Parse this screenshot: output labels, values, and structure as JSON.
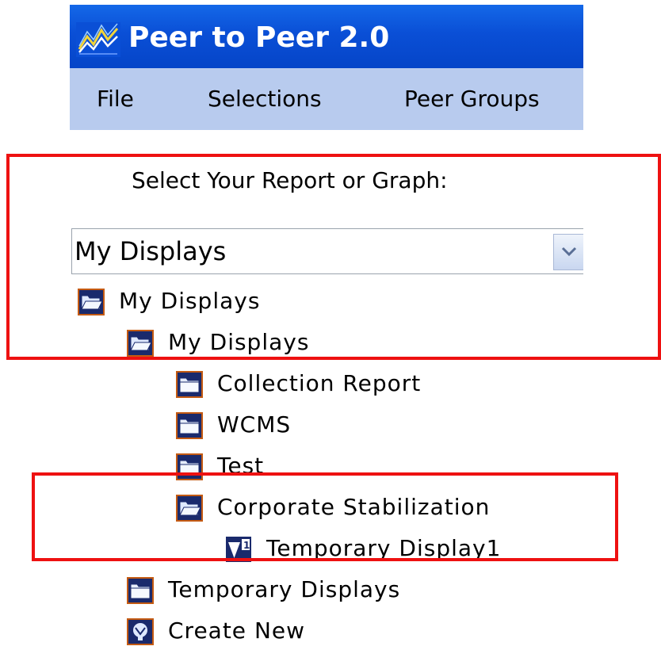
{
  "app": {
    "title": "Peer to Peer 2.0",
    "logo_icon": "chart-line-logo-icon"
  },
  "menu": {
    "items": [
      {
        "label": "File"
      },
      {
        "label": "Selections"
      },
      {
        "label": "Peer Groups"
      }
    ]
  },
  "content": {
    "prompt": "Select Your Report or Graph:",
    "dropdown": {
      "selected": "My Displays",
      "button_icon": "chevron-down-icon"
    }
  },
  "tree": {
    "items": [
      {
        "label": "My Displays",
        "icon": "folder-open-icon",
        "level": 0
      },
      {
        "label": "My Displays",
        "icon": "folder-open-icon",
        "level": 1
      },
      {
        "label": "Collection Report",
        "icon": "folder-closed-icon",
        "level": 2
      },
      {
        "label": "WCMS",
        "icon": "folder-closed-icon",
        "level": 2
      },
      {
        "label": "Test",
        "icon": "folder-closed-icon",
        "level": 2
      },
      {
        "label": "Corporate Stabilization",
        "icon": "folder-open-icon",
        "level": 2
      },
      {
        "label": "Temporary Display1",
        "icon": "display-item-icon",
        "level": 3
      },
      {
        "label": "Temporary Displays",
        "icon": "folder-closed-icon",
        "level": 1
      },
      {
        "label": "Create New",
        "icon": "create-new-icon",
        "level": 1
      }
    ]
  },
  "colors": {
    "titlebar": "#0a4fd6",
    "menubar": "#b8cbee",
    "highlight": "#ee1111"
  }
}
